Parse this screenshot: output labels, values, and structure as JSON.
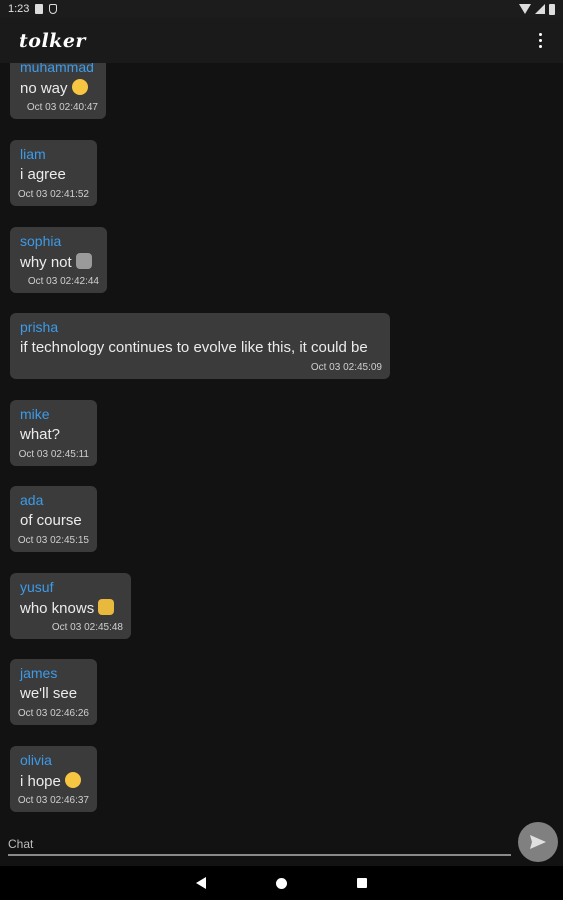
{
  "status_bar": {
    "time": "1:23"
  },
  "app_bar": {
    "title": "tolker"
  },
  "messages": [
    {
      "user": "muhammad",
      "text": "no way",
      "emoji": "laugh",
      "time": "Oct 03  02:40:47"
    },
    {
      "user": "liam",
      "text": "i agree",
      "emoji": "",
      "time": "Oct 03  02:41:52"
    },
    {
      "user": "sophia",
      "text": "why not",
      "emoji": "muscle",
      "time": "Oct 03  02:42:44"
    },
    {
      "user": "prisha",
      "text": "if technology continues to evolve like this, it could be",
      "emoji": "",
      "time": "Oct 03  02:45:09"
    },
    {
      "user": "mike",
      "text": "what?",
      "emoji": "",
      "time": "Oct 03  02:45:11"
    },
    {
      "user": "ada",
      "text": "of course",
      "emoji": "",
      "time": "Oct 03  02:45:15"
    },
    {
      "user": "yusuf",
      "text": "who knows",
      "emoji": "shrug",
      "time": "Oct 03  02:45:48"
    },
    {
      "user": "james",
      "text": "we'll see",
      "emoji": "",
      "time": "Oct 03  02:46:26"
    },
    {
      "user": "olivia",
      "text": "i hope",
      "emoji": "smile",
      "time": "Oct 03  02:46:37"
    }
  ],
  "composer": {
    "placeholder": "Chat"
  }
}
